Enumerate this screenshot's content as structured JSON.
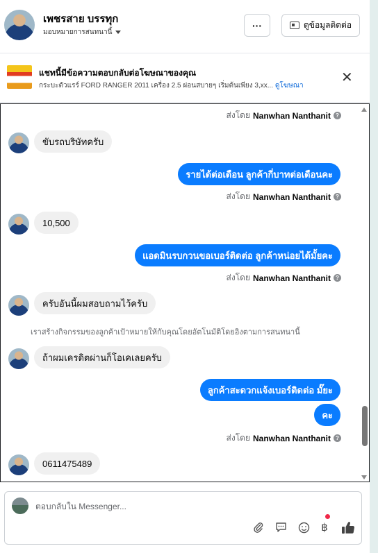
{
  "header": {
    "name": "เพชรสาย บรรทุก",
    "assign_label": "มอบหมายการสนทนานี้",
    "more_label": "···",
    "contact_label": "ดูข้อมูลติดต่อ"
  },
  "ad_banner": {
    "title": "แชทนี้มีข้อความตอบกลับต่อโฆษณาของคุณ",
    "description": "กระบะตัวแรร์ FORD RANGER 2011 เครื่อง 2.5 ผ่อนสบายๆ เริ่มต้นเพียง 3,xx...",
    "link_label": "ดูโฆษณา",
    "close_label": "✕"
  },
  "messages": {
    "sent_by_prefix": "ส่งโดย",
    "sender_name": "Nanwhan Nanthanit",
    "m1": "ขับรถบริษัทครับ",
    "m2": "รายได้ต่อเดือน ลูกค้ากี่บาทต่อเดือนคะ",
    "m3": "10,500",
    "m4": "แอดมินรบกวนขอเบอร์ติดต่อ ลูกค้าหน่อยได้มั้ยคะ",
    "m5": "ครับอันนี้ผมสอบถามไว้ครับ",
    "notice": "เราสร้างกิจกรรมของลูกค้าเป้าหมายให้กับคุณโดยอัตโนมัติโดยอิงตามการสนทนานี้",
    "m6": "ถ้าผมเครดิตผ่านก็โอเคเลยครับ",
    "m7": "ลูกค้าสะดวกแจ้งเบอร์ติดต่อ มั๊ยะ",
    "m8": "คะ",
    "m9": "0611475489"
  },
  "composer": {
    "placeholder": "ตอบกลับใน Messenger...",
    "icons": [
      "paperclip-icon",
      "chat-bubble-icon",
      "emoji-icon",
      "baht-icon",
      "thumbs-up-icon"
    ]
  },
  "colors": {
    "outgoing_bubble": "#0a7cff",
    "incoming_bubble": "#f0f0f0",
    "notification_dot": "#f02849"
  }
}
